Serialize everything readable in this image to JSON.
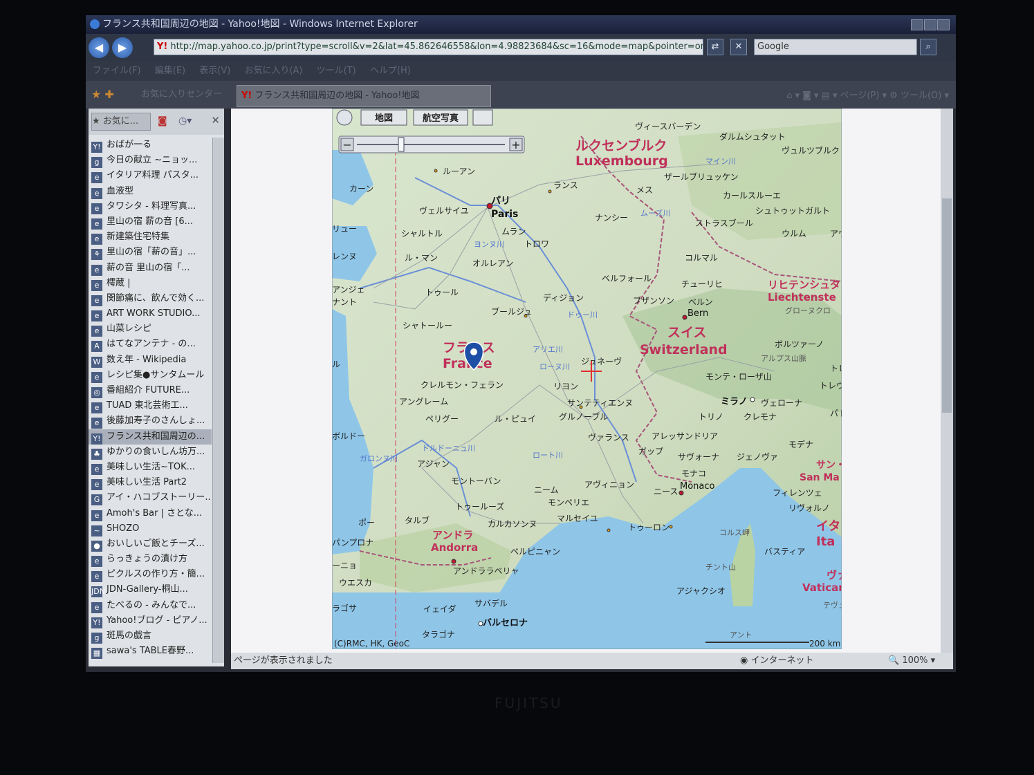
{
  "window": {
    "title": "フランス共和国周辺の地図 - Yahoo!地図 - Windows Internet Explorer"
  },
  "address": {
    "url": "http://map.yahoo.co.jp/print?type=scroll&v=2&lat=45.862646558&lon=4.98823684&sc=16&mode=map&pointer=on&home=on",
    "search": "Google"
  },
  "menu": [
    "ファイル(F)",
    "編集(E)",
    "表示(V)",
    "お気に入り(A)",
    "ツール(T)",
    "ヘルプ(H)"
  ],
  "tabs": {
    "favorites_center": "お気に入りセンター",
    "active": "フランス共和国周辺の地図 - Yahoo!地図",
    "page": "ページ(P)",
    "tools": "ツール(O)"
  },
  "sidebar": {
    "title": "お気に...",
    "items": [
      {
        "label": "おばが一る",
        "icon": "Y!"
      },
      {
        "label": "今日の献立 ~ニョッ...",
        "icon": "g"
      },
      {
        "label": "イタリア料理 パスタ...",
        "icon": "e"
      },
      {
        "label": "血液型",
        "icon": "e"
      },
      {
        "label": "タワシタ - 料理写真...",
        "icon": "e"
      },
      {
        "label": "里山の宿 薪の音 [6...",
        "icon": "e"
      },
      {
        "label": "新建築住宅特集",
        "icon": "e"
      },
      {
        "label": "里山の宿「薪の音」...",
        "icon": "⚘"
      },
      {
        "label": "薪の音 里山の宿「...",
        "icon": "e"
      },
      {
        "label": "樗蔵 |",
        "icon": "e"
      },
      {
        "label": "関節痛に、飲んで効く...",
        "icon": "e"
      },
      {
        "label": "ART WORK STUDIO...",
        "icon": "e"
      },
      {
        "label": "山菜レシピ",
        "icon": "e"
      },
      {
        "label": "はてなアンテナ - の...",
        "icon": "A"
      },
      {
        "label": "数え年 - Wikipedia",
        "icon": "W"
      },
      {
        "label": "レシピ集●サンタムール",
        "icon": "e"
      },
      {
        "label": "番組紹介 FUTURE...",
        "icon": "◎"
      },
      {
        "label": "TUAD 東北芸術工...",
        "icon": "e"
      },
      {
        "label": "後藤加寿子のさんしょ...",
        "icon": "e"
      },
      {
        "label": "フランス共和国周辺の...",
        "icon": "Y!"
      },
      {
        "label": "ゆかりの食いしん坊万...",
        "icon": "♣"
      },
      {
        "label": "美味しい生活~TOK...",
        "icon": "e"
      },
      {
        "label": "美味しい生活 Part2",
        "icon": "e"
      },
      {
        "label": "アイ・ハコブストーリー...",
        "icon": "G"
      },
      {
        "label": "Amoh's Bar | さとな...",
        "icon": "e"
      },
      {
        "label": "SHOZO",
        "icon": "~"
      },
      {
        "label": "おいしいご飯とチーズ...",
        "icon": "●"
      },
      {
        "label": "らっきょうの漬け方",
        "icon": "e"
      },
      {
        "label": "ピクルスの作り方・簡...",
        "icon": "e"
      },
      {
        "label": "JDN-Gallery-桐山...",
        "icon": "JDN"
      },
      {
        "label": "たべるの - みんなで...",
        "icon": "e"
      },
      {
        "label": "Yahoo!ブログ - ピアノ...",
        "icon": "Y!"
      },
      {
        "label": "斑馬の戯言",
        "icon": "g"
      },
      {
        "label": "sawa's TABLE春野...",
        "icon": "▦"
      }
    ]
  },
  "map_controls": {
    "map": "地図",
    "aerial": "航空写真"
  },
  "map": {
    "labels": [
      {
        "t": "ヴィースバーデン"
      },
      {
        "t": "ダルムシュタット"
      },
      {
        "t": "ヴュルツブルク"
      },
      {
        "t": "ルクセンブルク"
      },
      {
        "t": "Luxembourg"
      },
      {
        "t": "マイン川"
      },
      {
        "t": "ザールブリュッケン"
      },
      {
        "t": "ルーアン"
      },
      {
        "t": "カーン"
      },
      {
        "t": "ランス"
      },
      {
        "t": "メス"
      },
      {
        "t": "カールスルーエ"
      },
      {
        "t": "パリ"
      },
      {
        "t": "Paris"
      },
      {
        "t": "ヴェルサイユ"
      },
      {
        "t": "シュトゥットガルト"
      },
      {
        "t": "ムラン"
      },
      {
        "t": "ナンシー"
      },
      {
        "t": "ムーズ川"
      },
      {
        "t": "ストラスブール"
      },
      {
        "t": "シャルトル"
      },
      {
        "t": "ウルム"
      },
      {
        "t": "アウク"
      },
      {
        "t": "リュー"
      },
      {
        "t": "ヨンヌ川"
      },
      {
        "t": "トロワ"
      },
      {
        "t": "レンヌ"
      },
      {
        "t": "ル・マン"
      },
      {
        "t": "オルレアン"
      },
      {
        "t": "コルマル"
      },
      {
        "t": "ベルフォール"
      },
      {
        "t": "チューリヒ"
      },
      {
        "t": "アンジェ"
      },
      {
        "t": "ナント"
      },
      {
        "t": "トゥール"
      },
      {
        "t": "ディジョン"
      },
      {
        "t": "ブザンソン"
      },
      {
        "t": "ベルン"
      },
      {
        "t": "Bern"
      },
      {
        "t": "リヒテンシュタ"
      },
      {
        "t": "Liechtenste"
      },
      {
        "t": "グローヌクロ"
      },
      {
        "t": "ブールジュ"
      },
      {
        "t": "シャトールー"
      },
      {
        "t": "ドゥー川"
      },
      {
        "t": "スイス"
      },
      {
        "t": "Switzerland"
      },
      {
        "t": "ボルツァーノ"
      },
      {
        "t": "アルプス山脈"
      },
      {
        "t": "フランス"
      },
      {
        "t": "France"
      },
      {
        "t": "アリエ川"
      },
      {
        "t": "ローヌ川"
      },
      {
        "t": "ジュネーヴ"
      },
      {
        "t": "モンテ・ローザ山"
      },
      {
        "t": "トレ"
      },
      {
        "t": "トレヴ"
      },
      {
        "t": "ル"
      },
      {
        "t": "クレルモン・フェラン"
      },
      {
        "t": "リヨン"
      },
      {
        "t": "アングレーム"
      },
      {
        "t": "サンテティエンヌ"
      },
      {
        "t": "ミラノ"
      },
      {
        "t": "ヴェローナ"
      },
      {
        "t": "パド"
      },
      {
        "t": "ペリグー"
      },
      {
        "t": "ル・ピュイ"
      },
      {
        "t": "グルノーブル"
      },
      {
        "t": "トリノ"
      },
      {
        "t": "クレモナ"
      },
      {
        "t": "ボルドー"
      },
      {
        "t": "ドルドーニュ川"
      },
      {
        "t": "ヴァランス"
      },
      {
        "t": "アレッサンドリア"
      },
      {
        "t": "モデナ"
      },
      {
        "t": "ガロンヌ川"
      },
      {
        "t": "ロート川"
      },
      {
        "t": "ガップ"
      },
      {
        "t": "サヴォーナ"
      },
      {
        "t": "ジェノヴァ"
      },
      {
        "t": "アジャン"
      },
      {
        "t": "サン・"
      },
      {
        "t": "San Ma"
      },
      {
        "t": "モントーバン"
      },
      {
        "t": "モナコ"
      },
      {
        "t": "Monaco"
      },
      {
        "t": "ニーム"
      },
      {
        "t": "アヴィニョン"
      },
      {
        "t": "ニース"
      },
      {
        "t": "フィレンツェ"
      },
      {
        "t": "トゥールーズ"
      },
      {
        "t": "モンペリエ"
      },
      {
        "t": "リヴォルノ"
      },
      {
        "t": "ポー"
      },
      {
        "t": "タルブ"
      },
      {
        "t": "カルカソンヌ"
      },
      {
        "t": "マルセイユ"
      },
      {
        "t": "トゥーロン"
      },
      {
        "t": "イタ"
      },
      {
        "t": "Ita"
      },
      {
        "t": "パンプロナ"
      },
      {
        "t": "アンドラ"
      },
      {
        "t": "Andorra"
      },
      {
        "t": "コルス岬"
      },
      {
        "t": "ペルピニャン"
      },
      {
        "t": "バスティア"
      },
      {
        "t": "ーニョ"
      },
      {
        "t": "アンドララベリャ"
      },
      {
        "t": "チント山"
      },
      {
        "t": "ウエスカ"
      },
      {
        "t": "ヴァチ"
      },
      {
        "t": "Vatican"
      },
      {
        "t": "アジャクシオ"
      },
      {
        "t": "テヴェ"
      },
      {
        "t": "ラゴサ"
      },
      {
        "t": "イェイダ"
      },
      {
        "t": "サバデル"
      },
      {
        "t": "バルセロナ"
      },
      {
        "t": "タラゴナ"
      },
      {
        "t": "アント"
      },
      {
        "t": "(C)RMC, HK, GeoC"
      },
      {
        "t": "200 km"
      }
    ]
  },
  "status": {
    "text": "ページが表示されました",
    "zone": "インターネット",
    "zoom": "100%"
  },
  "bezel": {
    "brand": "FUJITSU"
  },
  "colors": {
    "sea": "#8fc6e8",
    "land": "#cfe0c6",
    "capital": "#c01830",
    "river": "#6b8fd6"
  }
}
